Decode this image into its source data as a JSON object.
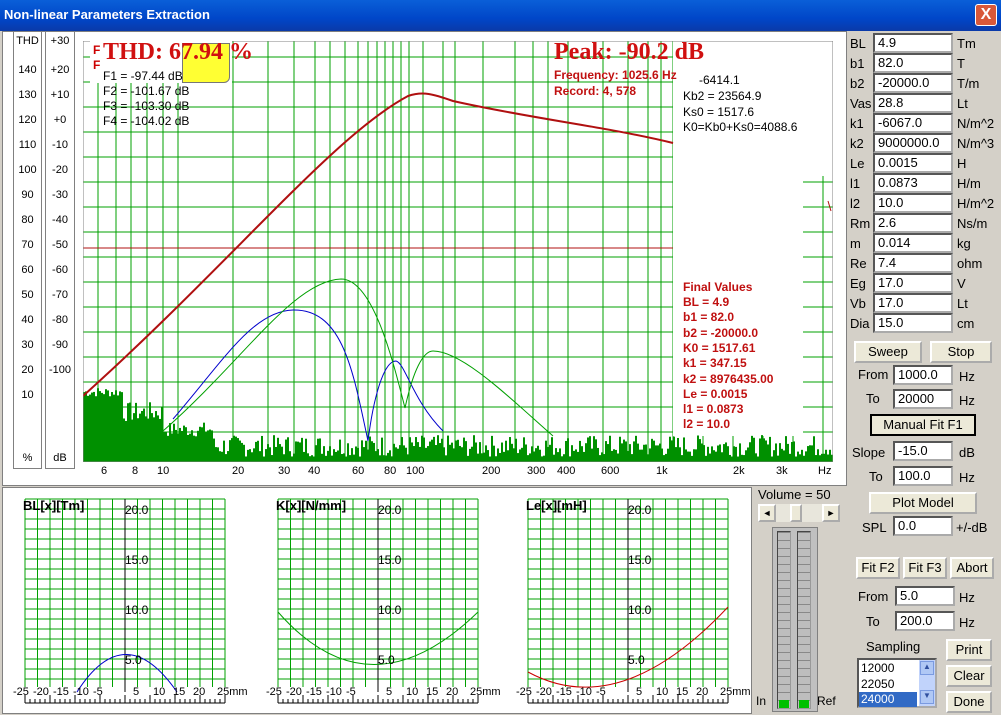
{
  "window": {
    "title": "Non-linear Parameters Extraction",
    "close": "X"
  },
  "thd_scale": {
    "header": "THD",
    "unit": "%",
    "ticks": [
      "140",
      "130",
      "120",
      "110",
      "100",
      "90",
      "80",
      "70",
      "60",
      "50",
      "40",
      "30",
      "20",
      "10"
    ]
  },
  "db_scale": {
    "header": "+30",
    "unit": "dB",
    "ticks": [
      "+20",
      "+10",
      "+0",
      "-10",
      "-20",
      "-30",
      "-40",
      "-50",
      "-60",
      "-70",
      "-80",
      "-90",
      "-100"
    ]
  },
  "readout": {
    "thd": "THD: 67.94 %",
    "peak": "Peak: -90.2 dB",
    "frequency": "Frequency: 1025.6 Hz",
    "record": "Record: 4,  578"
  },
  "f_values": [
    "F1 = -97.44 dB",
    "F2 = -101.67 dB",
    "F3 = -103.30 dB",
    "F4 = -104.02 dB"
  ],
  "f_markers": [
    "F",
    "F"
  ],
  "k_values": [
    "-6414.1",
    "Kb2 = 23564.9",
    "Ks0 = 1517.6",
    "K0=Kb0+Ks0=4088.6"
  ],
  "final_values": {
    "title": "Final Values",
    "items": [
      "BL = 4.9",
      "b1 = 82.0",
      "b2 = -20000.0",
      "K0 = 1517.61",
      "k1 = 347.15",
      "k2 = 8976435.00",
      "Le = 0.0015",
      "l1 = 0.0873",
      "l2 = 10.0"
    ]
  },
  "x_axis": {
    "ticks": [
      "6",
      "8",
      "10",
      "20",
      "30",
      "40",
      "60",
      "80",
      "100",
      "200",
      "300",
      "400",
      "600",
      "1k",
      "2k",
      "3k",
      "Hz"
    ]
  },
  "bottom_plots": [
    {
      "title": "BL[x][Tm]",
      "color": "#0000cc",
      "y_labels": [
        "20.0",
        "15.0",
        "10.0",
        "5.0"
      ]
    },
    {
      "title": "K[x][N/mm]",
      "color": "#00a000",
      "y_labels": [
        "20.0",
        "15.0",
        "10.0",
        "5.0"
      ]
    },
    {
      "title": "Le[x][mH]",
      "color": "#cc0000",
      "y_labels": [
        "20.0",
        "15.0",
        "10.0",
        "5.0"
      ]
    }
  ],
  "x_mm_axis": [
    "-25",
    "-20",
    "-15",
    "-10",
    "-5",
    "",
    "5",
    "10",
    "15",
    "20",
    "25mm"
  ],
  "volume": {
    "label": "Volume = 50",
    "in": "In",
    "ref": "Ref",
    "left": "◄",
    "right": "►"
  },
  "params": [
    {
      "label": "BL",
      "value": "4.9",
      "unit": "Tm"
    },
    {
      "label": "b1",
      "value": "82.0",
      "unit": "T"
    },
    {
      "label": "b2",
      "value": "-20000.0",
      "unit": "T/m"
    },
    {
      "label": "Vas",
      "value": "28.8",
      "unit": "Lt"
    },
    {
      "label": "k1",
      "value": "-6067.0",
      "unit": "N/m^2"
    },
    {
      "label": "k2",
      "value": "9000000.0",
      "unit": "N/m^3"
    },
    {
      "label": "Le",
      "value": "0.0015",
      "unit": "H"
    },
    {
      "label": "l1",
      "value": "0.0873",
      "unit": "H/m"
    },
    {
      "label": "l2",
      "value": "10.0",
      "unit": "H/m^2"
    },
    {
      "label": "Rm",
      "value": "2.6",
      "unit": "Ns/m"
    },
    {
      "label": "m",
      "value": "0.014",
      "unit": "kg"
    },
    {
      "label": "Re",
      "value": "7.4",
      "unit": "ohm"
    },
    {
      "label": "Eg",
      "value": "17.0",
      "unit": "V"
    },
    {
      "label": "Vb",
      "value": "17.0",
      "unit": "Lt"
    },
    {
      "label": "Dia",
      "value": "15.0",
      "unit": "cm"
    }
  ],
  "controls": {
    "sweep": "Sweep",
    "stop": "Stop",
    "from_label": "From",
    "from_value": "1000.0",
    "from_unit": "Hz",
    "to_label": "To",
    "to_value": "20000",
    "to_unit": "Hz",
    "manual_fit": "Manual Fit F1",
    "slope_label": "Slope",
    "slope_value": "-15.0",
    "slope_unit": "dB",
    "to2_label": "To",
    "to2_value": "100.0",
    "to2_unit": "Hz",
    "plot_model": "Plot Model",
    "spl_label": "SPL",
    "spl_value": "0.0",
    "spl_unit": "+/-dB",
    "fit_f2": "Fit F2",
    "fit_f3": "Fit F3",
    "abort": "Abort",
    "from2_label": "From",
    "from2_value": "5.0",
    "from2_unit": "Hz",
    "to3_label": "To",
    "to3_value": "200.0",
    "to3_unit": "Hz",
    "sampling_label": "Sampling",
    "sampling_options": [
      "12000",
      "22050",
      "24000"
    ],
    "sampling_selected": "24000",
    "print": "Print",
    "clear": "Clear",
    "done": "Done"
  },
  "colors": {
    "grid": "#00a000",
    "fundamental": "#b01010",
    "h2": "#0000cc",
    "h3": "#00a000",
    "noise": "#009000"
  }
}
